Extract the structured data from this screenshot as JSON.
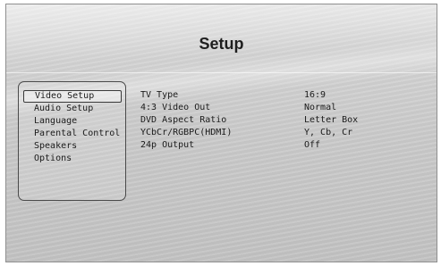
{
  "title": "Setup",
  "menu": {
    "items": [
      {
        "label": "Video Setup",
        "selected": true
      },
      {
        "label": "Audio Setup"
      },
      {
        "label": "Language"
      },
      {
        "label": "Parental Control"
      },
      {
        "label": "Speakers"
      },
      {
        "label": "Options"
      }
    ]
  },
  "settings": [
    {
      "label": "TV Type",
      "value": "16:9"
    },
    {
      "label": "4:3 Video Out",
      "value": "Normal"
    },
    {
      "label": "DVD Aspect Ratio",
      "value": "Letter Box"
    },
    {
      "label": "YCbCr/RGBPC(HDMI)",
      "value": "Y, Cb, Cr"
    },
    {
      "label": "24p Output",
      "value": "Off"
    }
  ]
}
